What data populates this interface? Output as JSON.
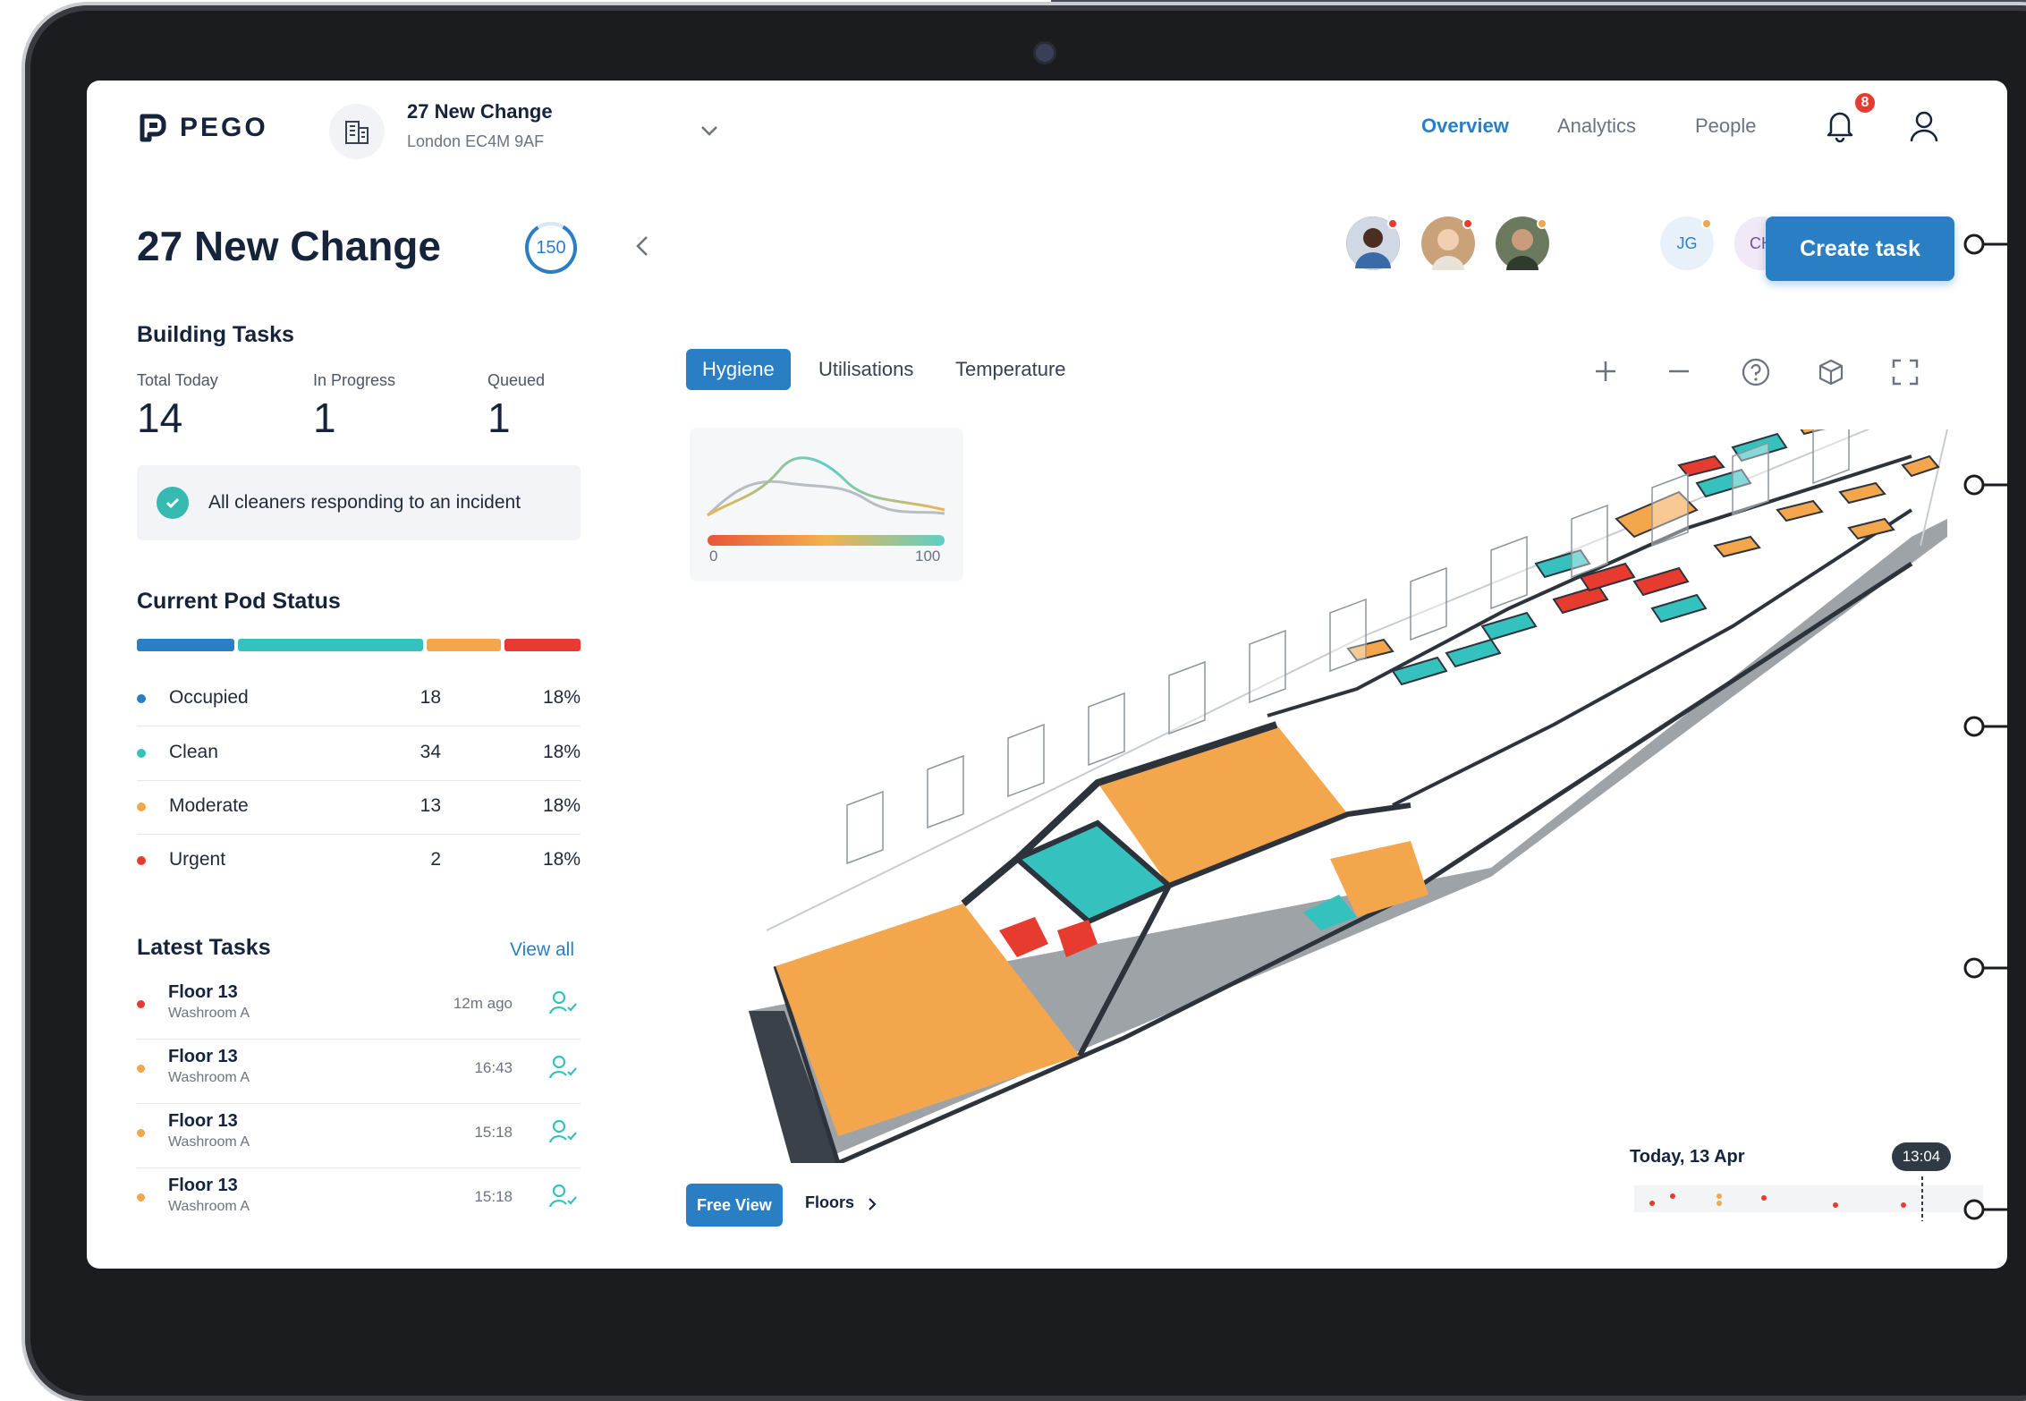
{
  "brand": {
    "name": "PEGO"
  },
  "building": {
    "name": "27 New Change",
    "address": "London EC4M 9AF"
  },
  "nav": {
    "overview": "Overview",
    "analytics": "Analytics",
    "people": "People"
  },
  "notifications": {
    "count": "8"
  },
  "page": {
    "title": "27 New Change",
    "score": "150"
  },
  "building_tasks": {
    "title": "Building Tasks",
    "stats": [
      {
        "label": "Total Today",
        "value": "14"
      },
      {
        "label": "In Progress",
        "value": "1"
      },
      {
        "label": "Queued",
        "value": "1"
      }
    ],
    "notice": "All cleaners responding to an incident"
  },
  "pod_status": {
    "title": "Current Pod Status",
    "rows": [
      {
        "name": "Occupied",
        "count": "18",
        "pct": "18%",
        "color": "#2a7fc4"
      },
      {
        "name": "Clean",
        "count": "34",
        "pct": "18%",
        "color": "#35c2be"
      },
      {
        "name": "Moderate",
        "count": "13",
        "pct": "18%",
        "color": "#f4a64c"
      },
      {
        "name": "Urgent",
        "count": "2",
        "pct": "18%",
        "color": "#e63b2e"
      }
    ]
  },
  "latest_tasks": {
    "title": "Latest Tasks",
    "view_all": "View all",
    "rows": [
      {
        "floor": "Floor 13",
        "room": "Washroom A",
        "time": "12m ago",
        "color": "#e63b2e"
      },
      {
        "floor": "Floor 13",
        "room": "Washroom A",
        "time": "16:43",
        "color": "#f4a64c"
      },
      {
        "floor": "Floor 13",
        "room": "Washroom A",
        "time": "15:18",
        "color": "#f4a64c"
      },
      {
        "floor": "Floor 13",
        "room": "Washroom A",
        "time": "15:18",
        "color": "#f4a64c"
      }
    ]
  },
  "team": {
    "initials": [
      "JG",
      "CH"
    ]
  },
  "actions": {
    "create_task": "Create task"
  },
  "tabs": [
    "Hygiene",
    "Utilisations",
    "Temperature"
  ],
  "legend": {
    "min": "0",
    "max": "100"
  },
  "view": {
    "free_view": "Free View",
    "floors": "Floors"
  },
  "timeline": {
    "date": "Today, 13 Apr",
    "time": "13:04"
  },
  "colors": {
    "accent": "#2a7fc4",
    "clean": "#35c2be",
    "moderate": "#f4a64c",
    "urgent": "#e63b2e"
  }
}
